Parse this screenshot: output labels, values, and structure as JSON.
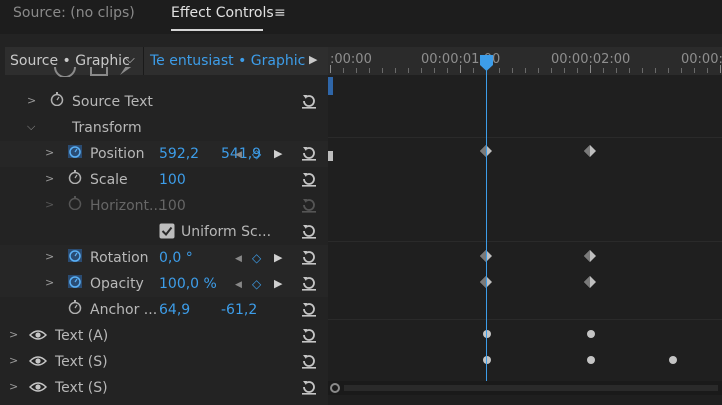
{
  "tabs": {
    "source": "Source: (no clips)",
    "effect_controls": "Effect Controls",
    "menu_icon": "hamburger-menu-icon"
  },
  "selector": {
    "source_label": "Source • Graphic",
    "clip_label": "Te entusiast • Graphic"
  },
  "timeline": {
    "timecodes": [
      ":00:00",
      "00:00:01:00",
      "00:00:02:00",
      "00:00:0"
    ],
    "accent": "#3d9de9"
  },
  "properties": {
    "source_text": "Source Text",
    "transform": "Transform",
    "position": {
      "label": "Position",
      "x": "592,2",
      "y": "541,9"
    },
    "scale": {
      "label": "Scale",
      "value": "100"
    },
    "horizontal": {
      "label": "Horizont...",
      "value": "100"
    },
    "uniform": {
      "label": "Uniform Sc..."
    },
    "rotation": {
      "label": "Rotation",
      "value": "0,0 °"
    },
    "opacity": {
      "label": "Opacity",
      "value": "100,0 %"
    },
    "anchor": {
      "label": "Anchor ...",
      "x": "64,9",
      "y": "-61,2"
    }
  },
  "layers": [
    {
      "label": "Text (A)"
    },
    {
      "label": "Text (S)"
    },
    {
      "label": "Text (S)"
    }
  ]
}
